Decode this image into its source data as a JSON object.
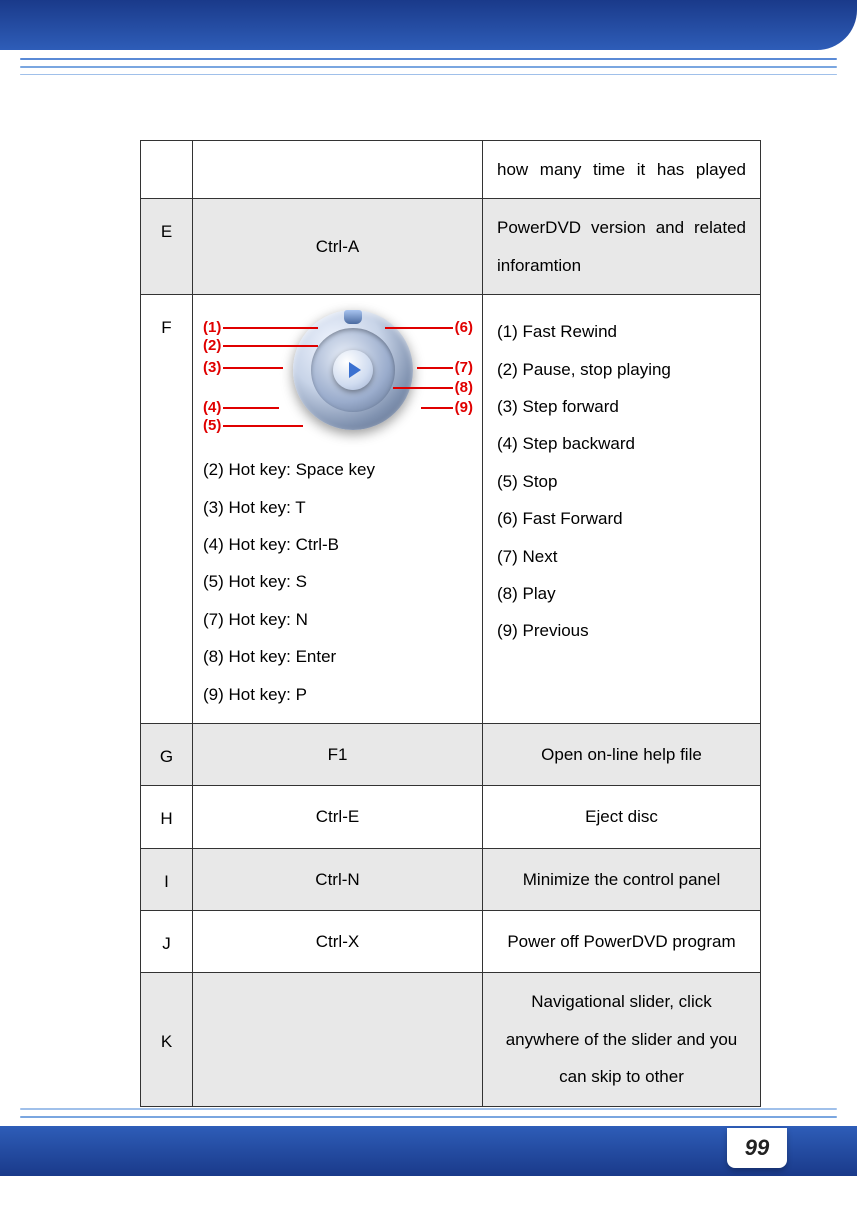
{
  "page_number": "99",
  "rows": {
    "pre": {
      "label": "",
      "key": "",
      "desc": "how many time it has played"
    },
    "E": {
      "label": "E",
      "key": "Ctrl-A",
      "desc": "PowerDVD version and related inforamtion"
    },
    "F": {
      "label": "F",
      "hotkeys": [
        "(2) Hot key: Space key",
        "(3) Hot key: T",
        "(4) Hot key: Ctrl-B",
        "(5) Hot key: S",
        "(7) Hot key: N",
        "(8) Hot key: Enter",
        "(9) Hot key: P"
      ],
      "functions": [
        "(1) Fast Rewind",
        "(2) Pause, stop playing",
        "(3) Step forward",
        "(4) Step backward",
        "(5) Stop",
        "(6) Fast Forward",
        "(7) Next",
        "(8) Play",
        "(9) Previous"
      ],
      "callouts": {
        "1": "(1)",
        "2": "(2)",
        "3": "(3)",
        "4": "(4)",
        "5": "(5)",
        "6": "(6)",
        "7": "(7)",
        "8": "(8)",
        "9": "(9)"
      }
    },
    "G": {
      "label": "G",
      "key": "F1",
      "desc": "Open on-line help file"
    },
    "H": {
      "label": "H",
      "key": "Ctrl-E",
      "desc": "Eject disc"
    },
    "I": {
      "label": "I",
      "key": "Ctrl-N",
      "desc": "Minimize the control panel"
    },
    "J": {
      "label": "J",
      "key": "Ctrl-X",
      "desc": "Power off PowerDVD program"
    },
    "K": {
      "label": "K",
      "key": "",
      "desc": "Navigational slider, click anywhere of the slider and you can skip to other"
    }
  }
}
